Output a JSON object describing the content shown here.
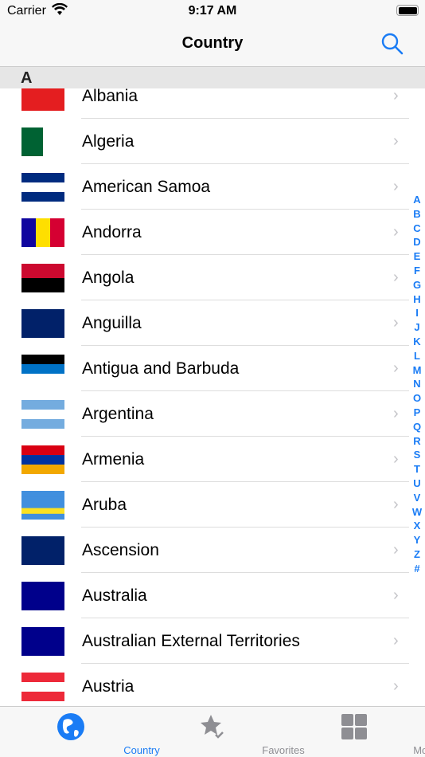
{
  "status": {
    "carrier": "Carrier",
    "time": "9:17 AM"
  },
  "nav": {
    "title": "Country"
  },
  "section": {
    "letter": "A"
  },
  "accent": "#1a7cf5",
  "countries": [
    {
      "name": "Albania",
      "flag": {
        "dir": "h",
        "colors": [
          "#e41e20"
        ]
      }
    },
    {
      "name": "Algeria",
      "flag": {
        "dir": "v",
        "colors": [
          "#006233",
          "#ffffff"
        ]
      }
    },
    {
      "name": "American Samoa",
      "flag": {
        "dir": "h",
        "colors": [
          "#002b7f",
          "#ffffff",
          "#002b7f"
        ]
      }
    },
    {
      "name": "Andorra",
      "flag": {
        "dir": "v",
        "colors": [
          "#10069f",
          "#fedf00",
          "#d50032"
        ]
      }
    },
    {
      "name": "Angola",
      "flag": {
        "dir": "h",
        "colors": [
          "#cc092f",
          "#000000"
        ]
      }
    },
    {
      "name": "Anguilla",
      "flag": {
        "dir": "h",
        "colors": [
          "#012169"
        ]
      }
    },
    {
      "name": "Antigua and Barbuda",
      "flag": {
        "dir": "h",
        "colors": [
          "#000000",
          "#0072c6",
          "#ffffff"
        ]
      }
    },
    {
      "name": "Argentina",
      "flag": {
        "dir": "h",
        "colors": [
          "#74acdf",
          "#ffffff",
          "#74acdf"
        ]
      }
    },
    {
      "name": "Armenia",
      "flag": {
        "dir": "h",
        "colors": [
          "#d90012",
          "#0033a0",
          "#f2a800"
        ]
      }
    },
    {
      "name": "Aruba",
      "flag": {
        "dir": "h",
        "colors": [
          "#418fde",
          "#418fde",
          "#418fde",
          "#fbe122",
          "#418fde"
        ]
      }
    },
    {
      "name": "Ascension",
      "flag": {
        "dir": "h",
        "colors": [
          "#012169"
        ]
      }
    },
    {
      "name": "Australia",
      "flag": {
        "dir": "h",
        "colors": [
          "#00008b"
        ]
      }
    },
    {
      "name": "Australian External Territories",
      "flag": {
        "dir": "h",
        "colors": [
          "#00008b"
        ]
      }
    },
    {
      "name": "Austria",
      "flag": {
        "dir": "h",
        "colors": [
          "#ed2939",
          "#ffffff",
          "#ed2939"
        ]
      }
    }
  ],
  "index": [
    "A",
    "B",
    "C",
    "D",
    "E",
    "F",
    "G",
    "H",
    "I",
    "J",
    "K",
    "L",
    "M",
    "N",
    "O",
    "P",
    "Q",
    "R",
    "S",
    "T",
    "U",
    "V",
    "W",
    "X",
    "Y",
    "Z",
    "#"
  ],
  "tabs": [
    {
      "label": "Country",
      "icon": "globe-icon",
      "active": true
    },
    {
      "label": "Favorites",
      "icon": "star-check-icon"
    },
    {
      "label": "More",
      "icon": "grid-icon"
    }
  ]
}
